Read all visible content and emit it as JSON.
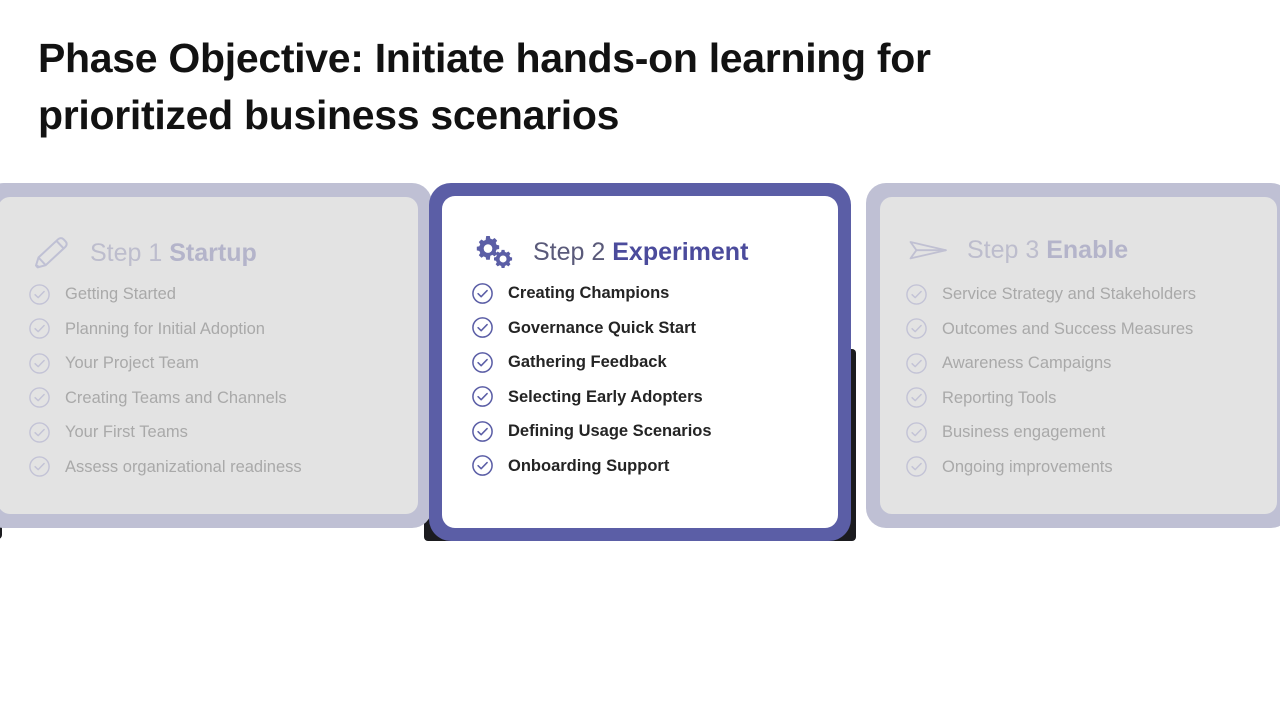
{
  "slide": {
    "title": "Phase Objective: Initiate hands-on learning for\nprioritized business scenarios"
  },
  "colors": {
    "active_border": "#5b5ea6",
    "active_accent": "#4b4b9c",
    "faded_border": "#bfc0d4",
    "faded_surface": "#e3e3e3",
    "faded_text": "#a9a9a9",
    "active_text": "#242424",
    "title_text": "#121212"
  },
  "cards": [
    {
      "id": "step-1-startup",
      "state": "faded",
      "icon": "pencil-icon",
      "step_label": "Step 1",
      "step_name": "Startup",
      "items": [
        "Getting Started",
        "Planning for Initial Adoption",
        "Your Project Team",
        "Creating Teams and Channels",
        "Your First Teams",
        "Assess organizational readiness"
      ]
    },
    {
      "id": "step-2-experiment",
      "state": "active",
      "icon": "gears-icon",
      "step_label": "Step 2",
      "step_name": "Experiment",
      "items": [
        "Creating Champions",
        "Governance Quick Start",
        "Gathering Feedback",
        "Selecting Early Adopters",
        "Defining Usage Scenarios",
        "Onboarding Support"
      ]
    },
    {
      "id": "step-3-enable",
      "state": "faded",
      "icon": "paper-plane-icon",
      "step_label": "Step 3",
      "step_name": "Enable",
      "items": [
        "Service Strategy and Stakeholders",
        "Outcomes and Success Measures",
        "Awareness Campaigns",
        "Reporting Tools",
        "Business engagement",
        "Ongoing improvements"
      ]
    }
  ]
}
